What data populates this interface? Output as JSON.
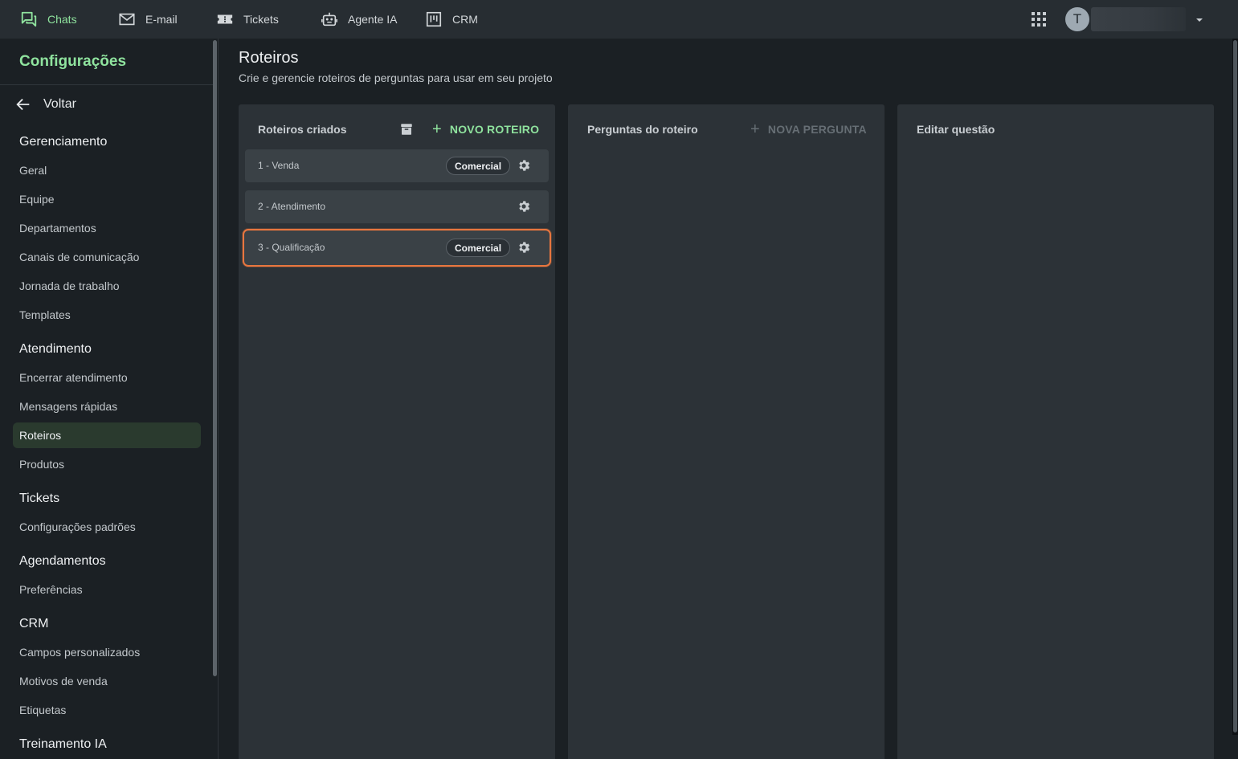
{
  "topnav": {
    "items": [
      {
        "label": "Chats",
        "icon": "chat-icon"
      },
      {
        "label": "E-mail",
        "icon": "mail-icon"
      },
      {
        "label": "Tickets",
        "icon": "ticket-icon"
      },
      {
        "label": "Agente IA",
        "icon": "robot-icon"
      },
      {
        "label": "CRM",
        "icon": "kanban-icon"
      }
    ],
    "avatar_initial": "T",
    "accent_color": "#8fe39e"
  },
  "sidebar": {
    "title": "Configurações",
    "back_label": "Voltar",
    "sections": [
      {
        "heading": "Gerenciamento",
        "items": [
          "Geral",
          "Equipe",
          "Departamentos",
          "Canais de comunicação",
          "Jornada de trabalho",
          "Templates"
        ]
      },
      {
        "heading": "Atendimento",
        "items": [
          "Encerrar atendimento",
          "Mensagens rápidas",
          "Roteiros",
          "Produtos"
        ]
      },
      {
        "heading": "Tickets",
        "items": [
          "Configurações padrões"
        ]
      },
      {
        "heading": "Agendamentos",
        "items": [
          "Preferências"
        ]
      },
      {
        "heading": "CRM",
        "items": [
          "Campos personalizados",
          "Motivos de venda",
          "Etiquetas"
        ]
      },
      {
        "heading": "Treinamento IA",
        "items": []
      }
    ],
    "active_item": "Roteiros"
  },
  "page": {
    "title": "Roteiros",
    "subtitle": "Crie e gerencie roteiros de perguntas para usar em seu projeto"
  },
  "columns": {
    "scripts": {
      "title": "Roteiros criados",
      "new_button": "NOVO ROTEIRO",
      "items": [
        {
          "name": "1 - Venda",
          "tag": "Comercial"
        },
        {
          "name": "2 - Atendimento",
          "tag": ""
        },
        {
          "name": "3 - Qualificação",
          "tag": "Comercial"
        }
      ],
      "selected_index": 2,
      "selected_color": "#e8763f"
    },
    "questions": {
      "title": "Perguntas do roteiro",
      "new_button": "NOVA PERGUNTA"
    },
    "edit": {
      "title": "Editar questão"
    }
  }
}
